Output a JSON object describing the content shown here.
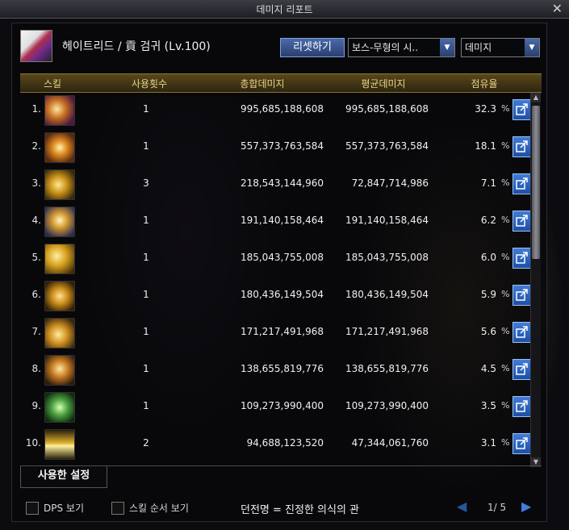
{
  "window_title": "데미지 리포트",
  "character": {
    "name": "헤이트리드 / 貢 검귀 (Lv.100)"
  },
  "controls": {
    "reset_label": "리셋하기",
    "boss_filter": "보스-무형의 시..",
    "type_filter": "데미지"
  },
  "columns": [
    "스킬",
    "사용횟수",
    "총합데미지",
    "평균데미지",
    "점유율"
  ],
  "rows": [
    {
      "rank": "1.",
      "uses": "1",
      "total": "995,685,188,608",
      "avg": "995,685,188,608",
      "pct": "32.3"
    },
    {
      "rank": "2.",
      "uses": "1",
      "total": "557,373,763,584",
      "avg": "557,373,763,584",
      "pct": "18.1"
    },
    {
      "rank": "3.",
      "uses": "3",
      "total": "218,543,144,960",
      "avg": "72,847,714,986",
      "pct": "7.1"
    },
    {
      "rank": "4.",
      "uses": "1",
      "total": "191,140,158,464",
      "avg": "191,140,158,464",
      "pct": "6.2"
    },
    {
      "rank": "5.",
      "uses": "1",
      "total": "185,043,755,008",
      "avg": "185,043,755,008",
      "pct": "6.0"
    },
    {
      "rank": "6.",
      "uses": "1",
      "total": "180,436,149,504",
      "avg": "180,436,149,504",
      "pct": "5.9"
    },
    {
      "rank": "7.",
      "uses": "1",
      "total": "171,217,491,968",
      "avg": "171,217,491,968",
      "pct": "5.6"
    },
    {
      "rank": "8.",
      "uses": "1",
      "total": "138,655,819,776",
      "avg": "138,655,819,776",
      "pct": "4.5"
    },
    {
      "rank": "9.",
      "uses": "1",
      "total": "109,273,990,400",
      "avg": "109,273,990,400",
      "pct": "3.5"
    },
    {
      "rank": "10.",
      "uses": "2",
      "total": "94,688,123,520",
      "avg": "47,344,061,760",
      "pct": "3.1"
    }
  ],
  "percent_sign": "%",
  "tab": {
    "used_settings": "사용한 설정"
  },
  "bottom": {
    "dps_view": "DPS 보기",
    "skill_order_view": "스킬 순서 보기",
    "dungeon_label": "던전명 = 진정한 의식의 관",
    "page": "1/ 5"
  },
  "colors": {
    "accent_blue": "#2a5cb0",
    "header_gold": "#e8d48a"
  }
}
